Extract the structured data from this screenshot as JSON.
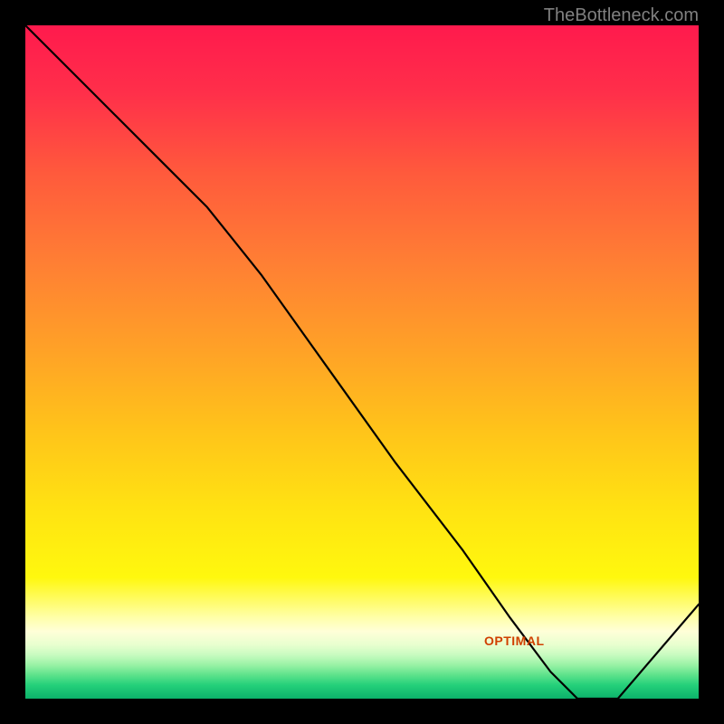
{
  "attribution": "TheBottleneck.com",
  "optimal_label": "OPTIMAL",
  "line_color": "#000000",
  "line_width": 2.2,
  "background_stops": [
    {
      "offset": 0.0,
      "color": "#ff1a4d"
    },
    {
      "offset": 0.1,
      "color": "#ff2f4a"
    },
    {
      "offset": 0.22,
      "color": "#ff5a3c"
    },
    {
      "offset": 0.35,
      "color": "#ff7e34"
    },
    {
      "offset": 0.48,
      "color": "#ffa127"
    },
    {
      "offset": 0.6,
      "color": "#ffc31a"
    },
    {
      "offset": 0.72,
      "color": "#ffe312"
    },
    {
      "offset": 0.82,
      "color": "#fff80e"
    },
    {
      "offset": 0.88,
      "color": "#ffffaa"
    },
    {
      "offset": 0.9,
      "color": "#ffffd8"
    },
    {
      "offset": 0.92,
      "color": "#e8ffcf"
    },
    {
      "offset": 0.935,
      "color": "#c8fbc0"
    },
    {
      "offset": 0.95,
      "color": "#99f2a5"
    },
    {
      "offset": 0.965,
      "color": "#5de28b"
    },
    {
      "offset": 0.98,
      "color": "#24d07a"
    },
    {
      "offset": 1.0,
      "color": "#0cb26a"
    }
  ],
  "chart_data": {
    "type": "line",
    "x": [
      0.0,
      0.1,
      0.2,
      0.27,
      0.35,
      0.45,
      0.55,
      0.65,
      0.72,
      0.78,
      0.82,
      0.88,
      1.0
    ],
    "y": [
      1.0,
      0.9,
      0.8,
      0.73,
      0.63,
      0.49,
      0.35,
      0.22,
      0.12,
      0.04,
      0.0,
      0.0,
      0.14
    ],
    "ylim": [
      0,
      1
    ],
    "xlim": [
      0,
      1
    ],
    "title": "",
    "xlabel": "",
    "ylabel": "",
    "annotations": [
      {
        "text": "OPTIMAL",
        "x": 0.82,
        "y": 0.01
      }
    ]
  }
}
